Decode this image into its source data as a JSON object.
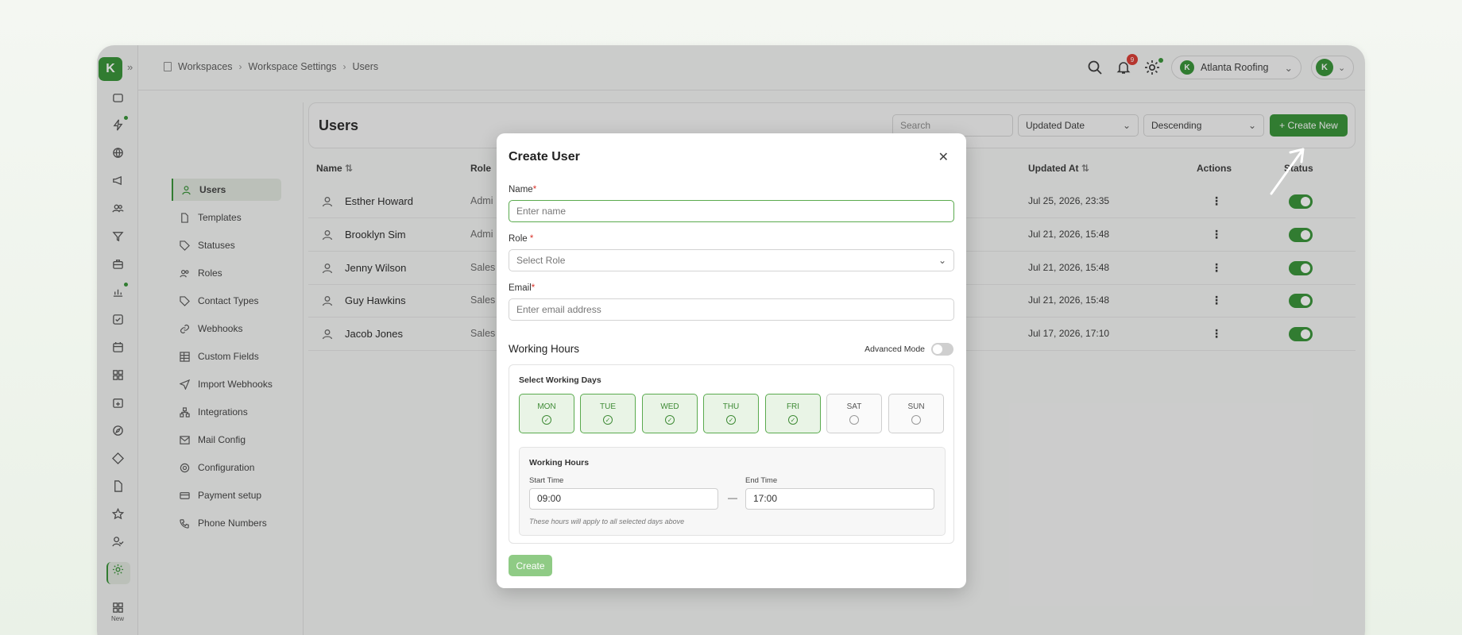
{
  "breadcrumb": [
    "Workspaces",
    "Workspace Settings",
    "Users"
  ],
  "topbar": {
    "notifications_count": "9",
    "org_name": "Atlanta Roofing",
    "org_initial": "K",
    "user_initial": "K"
  },
  "rail": {
    "logo": "K",
    "new_label": "New"
  },
  "settings_nav": [
    {
      "label": "Users",
      "icon": "user-icon"
    },
    {
      "label": "Templates",
      "icon": "file-icon"
    },
    {
      "label": "Statuses",
      "icon": "tag-icon"
    },
    {
      "label": "Roles",
      "icon": "users-icon"
    },
    {
      "label": "Contact Types",
      "icon": "tag-icon"
    },
    {
      "label": "Webhooks",
      "icon": "link-icon"
    },
    {
      "label": "Custom Fields",
      "icon": "table-icon"
    },
    {
      "label": "Import Webhooks",
      "icon": "send-icon"
    },
    {
      "label": "Integrations",
      "icon": "network-icon"
    },
    {
      "label": "Mail Config",
      "icon": "mail-icon"
    },
    {
      "label": "Configuration",
      "icon": "gear-icon"
    },
    {
      "label": "Payment setup",
      "icon": "card-icon"
    },
    {
      "label": "Phone Numbers",
      "icon": "phone-icon"
    }
  ],
  "users_panel": {
    "title": "Users",
    "search_placeholder": "Search",
    "sort_field": "Updated Date",
    "sort_order": "Descending",
    "create_label": "+ Create New",
    "columns": {
      "name": "Name",
      "role": "Role",
      "updated": "Updated At",
      "actions": "Actions",
      "status": "Status"
    },
    "rows": [
      {
        "name": "Esther Howard",
        "role": "Admi",
        "updated": "Jul 25, 2026, 23:35"
      },
      {
        "name": "Brooklyn Sim",
        "role": "Admi",
        "updated": "Jul 21, 2026, 15:48"
      },
      {
        "name": "Jenny Wilson",
        "role": "Sales",
        "updated": "Jul 21, 2026, 15:48"
      },
      {
        "name": "Guy Hawkins",
        "role": "Sales",
        "updated": "Jul 21, 2026, 15:48"
      },
      {
        "name": "Jacob Jones",
        "role": "Sales",
        "updated": "Jul 17, 2026, 17:10"
      }
    ]
  },
  "modal": {
    "title": "Create User",
    "name_label": "Name",
    "name_placeholder": "Enter name",
    "role_label": "Role",
    "role_placeholder": "Select Role",
    "email_label": "Email",
    "email_placeholder": "Enter email address",
    "working_hours_title": "Working Hours",
    "advanced_mode_label": "Advanced Mode",
    "select_days_label": "Select Working Days",
    "days": [
      {
        "label": "MON",
        "selected": true
      },
      {
        "label": "TUE",
        "selected": true
      },
      {
        "label": "WED",
        "selected": true
      },
      {
        "label": "THU",
        "selected": true
      },
      {
        "label": "FRI",
        "selected": true
      },
      {
        "label": "SAT",
        "selected": false
      },
      {
        "label": "SUN",
        "selected": false
      }
    ],
    "hours_box_title": "Working Hours",
    "start_label": "Start Time",
    "start_value": "09:00",
    "end_label": "End Time",
    "end_value": "17:00",
    "dash": "—",
    "note": "These hours will apply to all selected days above",
    "create_label": "Create"
  },
  "colors": {
    "brand": "#2f8f2f",
    "danger": "#d9342b",
    "selected_day_bg": "#e9f4e6"
  }
}
